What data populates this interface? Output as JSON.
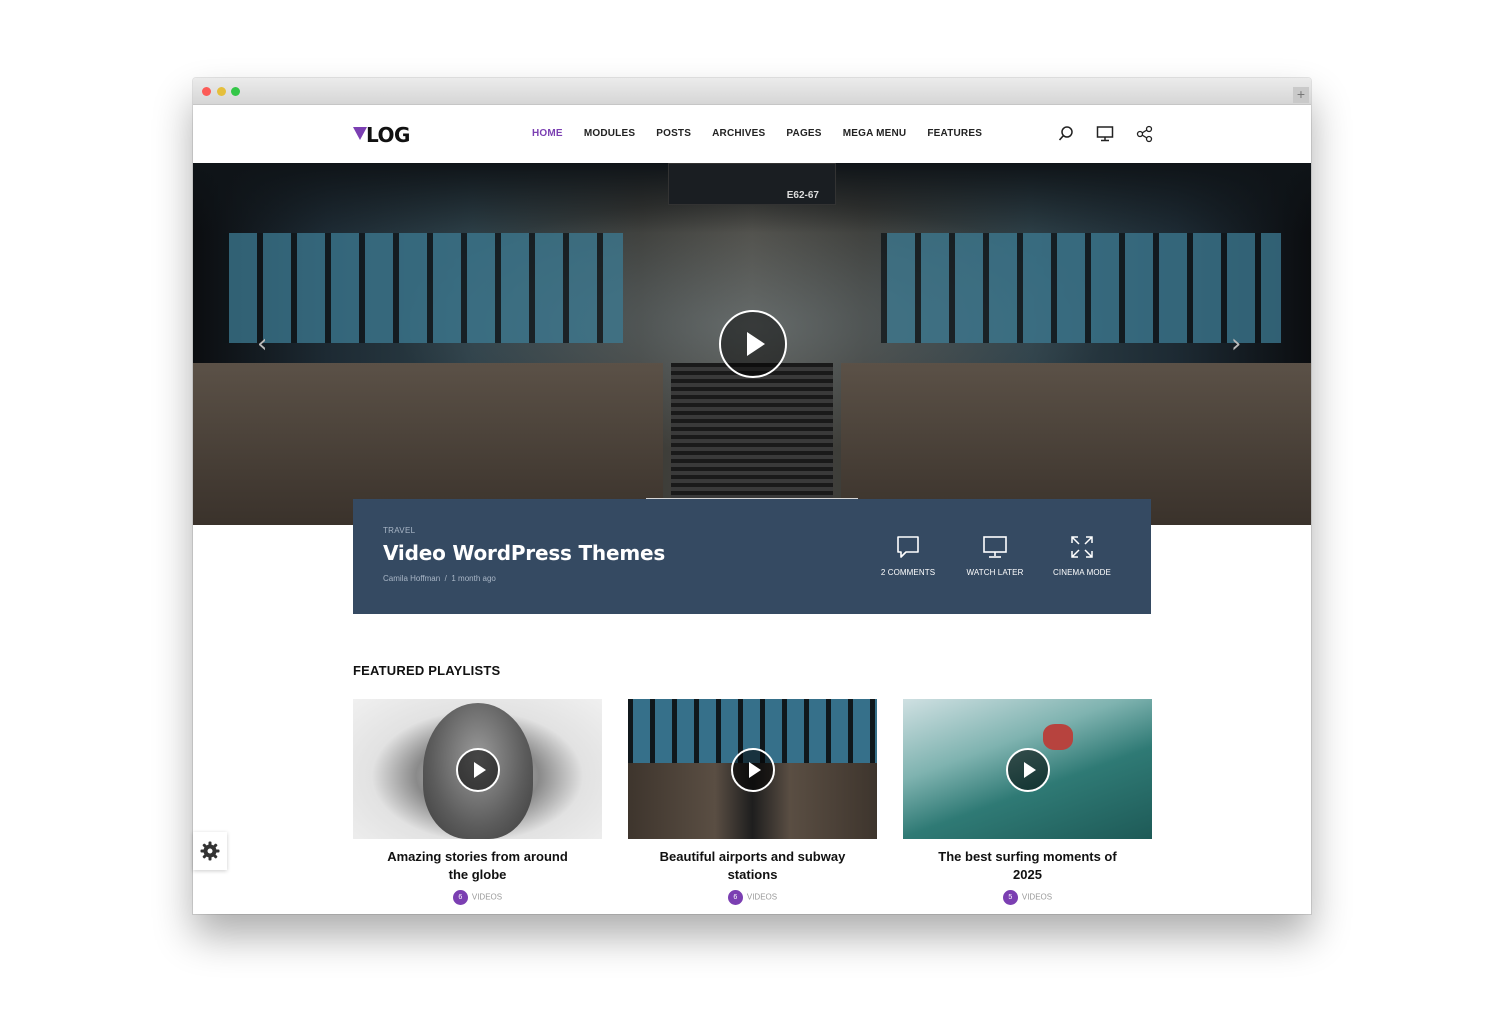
{
  "logo": {
    "text": "LOG"
  },
  "nav": {
    "items": [
      "HOME",
      "MODULES",
      "POSTS",
      "ARCHIVES",
      "PAGES",
      "MEGA MENU",
      "FEATURES"
    ],
    "active": "HOME"
  },
  "header_icons": [
    "search-icon",
    "monitor-icon",
    "share-icon"
  ],
  "hero": {
    "sign_text": "E62-67",
    "category": "TRAVEL",
    "title": "Video WordPress Themes",
    "author": "Camila Hoffman",
    "separator": "/",
    "date": "1 month ago",
    "actions": [
      {
        "label": "2 COMMENTS",
        "icon": "comment-icon"
      },
      {
        "label": "WATCH LATER",
        "icon": "monitor-icon"
      },
      {
        "label": "CINEMA MODE",
        "icon": "expand-icon"
      }
    ]
  },
  "section": {
    "title": "FEATURED PLAYLISTS"
  },
  "playlists": [
    {
      "title": "Amazing stories from around the globe",
      "count": "6",
      "unit": "VIDEOS"
    },
    {
      "title": "Beautiful airports and subway stations",
      "count": "6",
      "unit": "VIDEOS"
    },
    {
      "title": "The best surfing moments of 2025",
      "count": "5",
      "unit": "VIDEOS"
    }
  ],
  "colors": {
    "accent": "#7b3fb2",
    "infobar": "#354a62"
  }
}
